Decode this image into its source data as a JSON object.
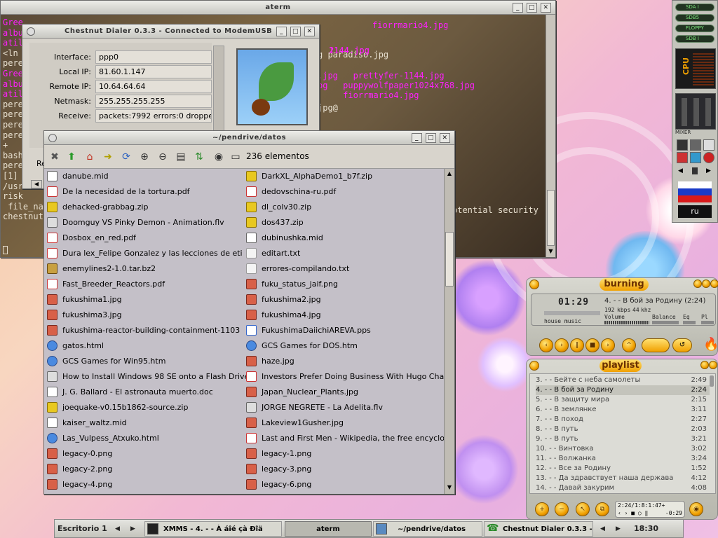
{
  "aterm": {
    "title": "aterm",
    "lines_left": [
      "Gree",
      "albu",
      "atil",
      "<ln",
      "pere",
      "Gree",
      "albu",
      "atil",
      "pere",
      "pere",
      "pere",
      "pere",
      "+",
      "bash",
      "pere",
      "[1]",
      "/usr",
      "risk",
      " file_na",
      "chestnut"
    ],
    "lines_right": [
      {
        "text": "fiorrmario4.jpg",
        "magenta": true
      },
      {
        "text": "2144.jpg",
        "magenta": true
      },
      {
        "text": "g paradiso.jpg",
        "magenta": false
      },
      {
        "text": "1144.jpg",
        "magenta": true
      },
      {
        "text": ".jpg   prettyfer-1144.jpg",
        "magenta": true
      },
      {
        "text": "pg   puppywolfpaper1024x768.jpg",
        "magenta": true
      },
      {
        "text": "     fiorrmario4.jpg",
        "magenta": true
      },
      {
        "text": "jpg@",
        "magenta": false
      },
      {
        "text": "otential security",
        "magenta": false
      }
    ]
  },
  "dialer": {
    "title": "Chestnut Dialer 0.3.3 - Connected to ModemUSB",
    "fields": [
      {
        "label": "Interface:",
        "value": "ppp0"
      },
      {
        "label": "Local IP:",
        "value": "81.60.1.147"
      },
      {
        "label": "Remote IP:",
        "value": "10.64.64.64"
      },
      {
        "label": "Netmask:",
        "value": "255.255.255.255"
      },
      {
        "label": "Receive:",
        "value": "packets:7992 errors:0 droppe"
      }
    ],
    "partial_label": "Re"
  },
  "fm": {
    "title": "~/pendrive/datos",
    "count": "236 elementos",
    "left_files": [
      {
        "name": "danube.mid",
        "type": "mid"
      },
      {
        "name": "De la necesidad de la tortura.pdf",
        "type": "pdf"
      },
      {
        "name": "dehacked-grabbag.zip",
        "type": "zip"
      },
      {
        "name": "Doomguy VS Pinky Demon - Animation.flv",
        "type": "flv"
      },
      {
        "name": "Dosbox_en_red.pdf",
        "type": "pdf"
      },
      {
        "name": "Dura lex_Felipe Gonzalez y las lecciones de eti",
        "type": "pdf"
      },
      {
        "name": "enemylines2-1.0.tar.bz2",
        "type": "bz2"
      },
      {
        "name": "Fast_Breeder_Reactors.pdf",
        "type": "pdf"
      },
      {
        "name": "fukushima1.jpg",
        "type": "img"
      },
      {
        "name": "fukushima3.jpg",
        "type": "img"
      },
      {
        "name": "fukushima-reactor-building-containment-1103",
        "type": "img"
      },
      {
        "name": "gatos.html",
        "type": "html"
      },
      {
        "name": "GCS Games for Win95.htm",
        "type": "html"
      },
      {
        "name": "How to Install Windows 98 SE onto a Flash Drive",
        "type": "flv"
      },
      {
        "name": "J. G. Ballard - El astronauta muerto.doc",
        "type": "doc"
      },
      {
        "name": "joequake-v0.15b1862-source.zip",
        "type": "zip"
      },
      {
        "name": "kaiser_waltz.mid",
        "type": "mid"
      },
      {
        "name": "Las_Vulpess_Atxuko.html",
        "type": "html"
      },
      {
        "name": "legacy-0.png",
        "type": "img"
      },
      {
        "name": "legacy-2.png",
        "type": "img"
      },
      {
        "name": "legacy-4.png",
        "type": "img"
      }
    ],
    "right_files": [
      {
        "name": "DarkXL_AlphaDemo1_b7f.zip",
        "type": "zip"
      },
      {
        "name": "dedovschina-ru.pdf",
        "type": "pdf"
      },
      {
        "name": "dl_colv30.zip",
        "type": "zip"
      },
      {
        "name": "dos437.zip",
        "type": "zip"
      },
      {
        "name": "dubinushka.mid",
        "type": "mid"
      },
      {
        "name": "editart.txt",
        "type": "txt"
      },
      {
        "name": "errores-compilando.txt",
        "type": "txt"
      },
      {
        "name": "fuku_status_jaif.png",
        "type": "img"
      },
      {
        "name": "fukushima2.jpg",
        "type": "img"
      },
      {
        "name": "fukushima4.jpg",
        "type": "img"
      },
      {
        "name": "FukushimaDaiichiAREVA.pps",
        "type": "pps"
      },
      {
        "name": "GCS Games for DOS.htm",
        "type": "html"
      },
      {
        "name": "haze.jpg",
        "type": "img"
      },
      {
        "name": "Investors Prefer Doing Business With Hugo Chav",
        "type": "pdf"
      },
      {
        "name": "Japan_Nuclear_Plants.jpg",
        "type": "img"
      },
      {
        "name": "JORGE NEGRETE -  La Adelita.flv",
        "type": "flv"
      },
      {
        "name": "Lakeview1Gusher.jpg",
        "type": "img"
      },
      {
        "name": "Last and First Men - Wikipedia, the free encyclop",
        "type": "pdf"
      },
      {
        "name": "legacy-1.png",
        "type": "img"
      },
      {
        "name": "legacy-3.png",
        "type": "img"
      },
      {
        "name": "legacy-6.png",
        "type": "img"
      }
    ]
  },
  "dock": {
    "drives": [
      "SDA I",
      "SDB5",
      "FLOPPY",
      "SDB I"
    ],
    "cpu_label": "CPU",
    "mixer_label": "MIXER",
    "lang": "ru"
  },
  "xmms": {
    "title": "burning",
    "time": "01:29",
    "song": "4. - - В бой за Родину (2:24)",
    "kbps": "192",
    "khz": "44",
    "kbps_unit": "kbps",
    "khz_unit": "khz",
    "house": "house music",
    "volume_label": "Volume",
    "balance_label": "Balance",
    "eq_label": "Eq",
    "pl_label": "Pl",
    "playlist_title": "playlist",
    "playlist": [
      {
        "t": "3. - - Бейте с неба самолеты",
        "d": "2:49"
      },
      {
        "t": "4. - - В бой за Родину",
        "d": "2:24"
      },
      {
        "t": "5. - - В защиту мира",
        "d": "2:15"
      },
      {
        "t": "6. - - В землянке",
        "d": "3:11"
      },
      {
        "t": "7. - - В поход",
        "d": "2:27"
      },
      {
        "t": "8. - - В путь",
        "d": "2:03"
      },
      {
        "t": "9. - - В путь",
        "d": "3:21"
      },
      {
        "t": "10. - - Винтовка",
        "d": "3:02"
      },
      {
        "t": "11. - - Волжанка",
        "d": "3:24"
      },
      {
        "t": "12. - - Все за Родину",
        "d": "1:52"
      },
      {
        "t": "13. - - Да здравствует наша держава",
        "d": "4:12"
      },
      {
        "t": "14. - - Давай закурим",
        "d": "4:08"
      }
    ],
    "pl_info": "2:24/1:8:1:47+",
    "pl_time": "-0:29"
  },
  "taskbar": {
    "desktop": "Escritorio 1",
    "tasks": [
      "XMMS - 4. - - À áîé çà Ðîä",
      "aterm",
      "~/pendrive/datos",
      "Chestnut Dialer 0.3.3 -"
    ],
    "clock": "18:30"
  },
  "colors": {
    "magenta": "#ff20ff",
    "accent": "#f0a000"
  }
}
